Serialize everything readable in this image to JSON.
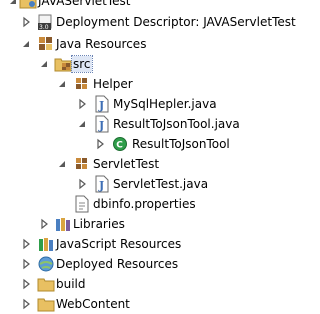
{
  "tree": {
    "project": "JAVAServletTest",
    "deployment_descriptor": "Deployment Descriptor: JAVAServletTest",
    "java_resources": "Java Resources",
    "src": "src",
    "helper_pkg": "Helper",
    "mysql_helper": "MySqlHepler.java",
    "result_tool_file": "ResultToJsonTool.java",
    "result_tool_class": "ResultToJsonTool",
    "servlet_pkg": "ServletTest",
    "servlet_file": "ServletTest.java",
    "dbinfo": "dbinfo.properties",
    "libraries": "Libraries",
    "js_resources": "JavaScript Resources",
    "deployed_resources": "Deployed Resources",
    "build": "build",
    "webcontent": "WebContent"
  },
  "icons": {
    "project": "web-project-icon",
    "deployment_descriptor": "deployment-descriptor-icon",
    "java_resources": "java-resources-icon",
    "source_folder": "source-folder-icon",
    "package": "package-icon",
    "java_file": "java-file-icon",
    "class": "class-icon",
    "properties_file": "properties-file-icon",
    "libraries": "libraries-icon",
    "js_resources": "javascript-resources-icon",
    "deployed_resources": "deployed-resources-icon",
    "folder": "folder-icon"
  },
  "colors": {
    "selection": "#dfe7f5",
    "folder": "#e8c062",
    "package": "#c98a3b",
    "class_green": "#2e9e4a",
    "java_blue": "#3f6fb5"
  }
}
